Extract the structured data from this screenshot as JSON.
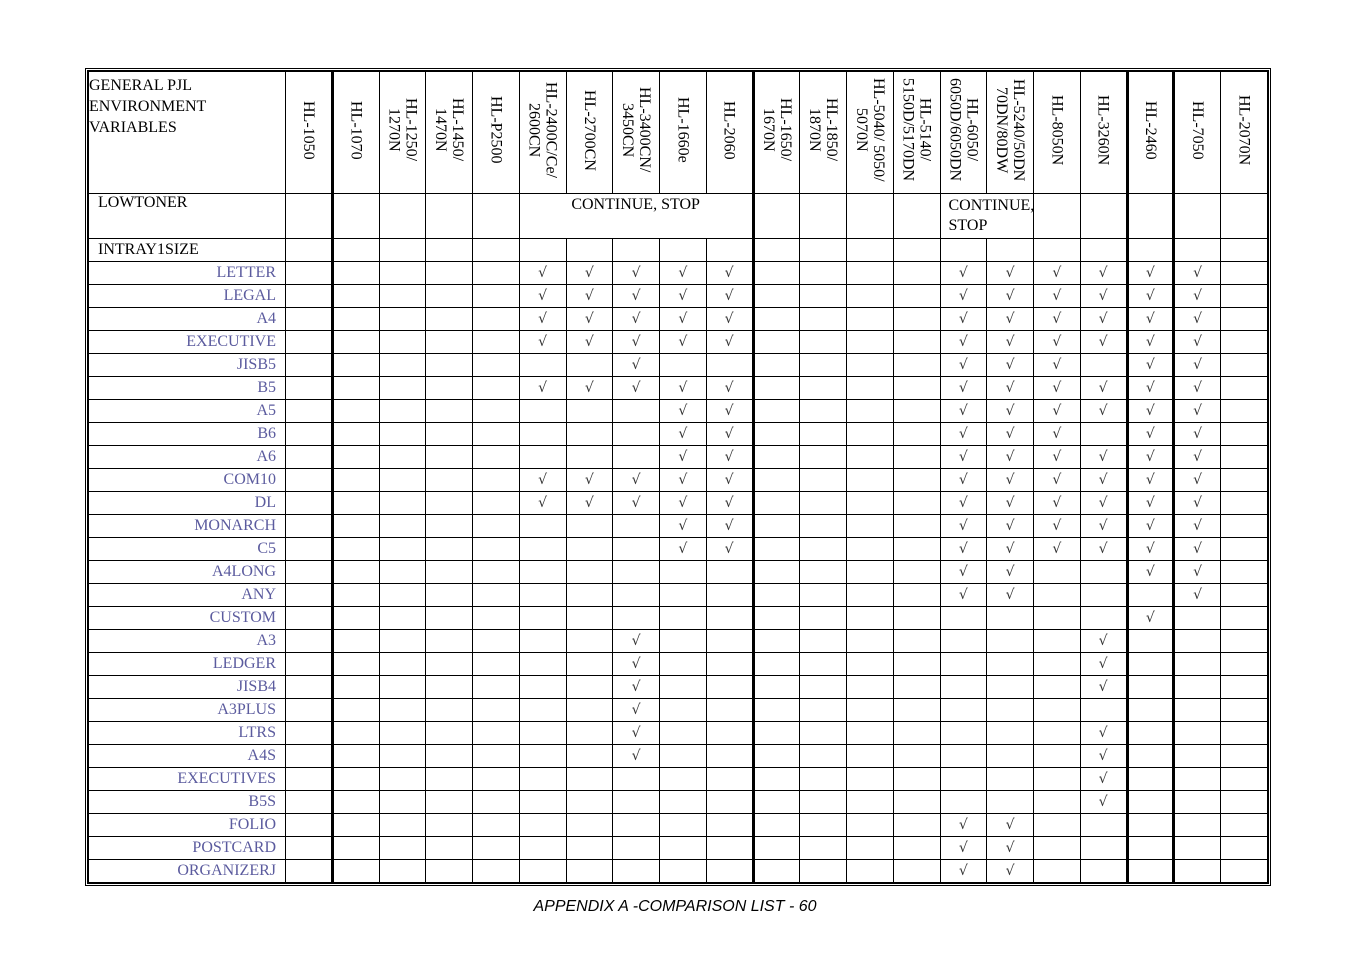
{
  "table": {
    "header_label": "GENERAL PJL ENVIRONMENT VARIABLES",
    "models": [
      "HL-1050",
      "HL-1070",
      "HL-1250/\n1270N",
      "HL-1450/\n1470N",
      "HL-P2500",
      "HL-2400C/Ce/\n2600CN",
      "HL-2700CN",
      "HL-3400CN/\n3450CN",
      "HL-1660e",
      "HL-2060",
      "HL-1650/\n1670N",
      "HL-1850/\n1870N",
      "HL-5040/ 5050/\n5070N",
      "HL-5140/\n5150D/5170DN",
      "HL-6050/\n6050D/6050DN",
      "HL-5240/50DN\n70DN/80DW",
      "HL-8050N",
      "HL-3260N",
      "HL-2460",
      "HL-7050",
      "HL-2070N"
    ],
    "thick_before": [
      1,
      10,
      18,
      19
    ],
    "lowtoner": {
      "label": "LOWTONER",
      "groups": [
        {
          "start": 5,
          "span": 5,
          "text": "CONTINUE, STOP",
          "align": "center"
        },
        {
          "start": 14,
          "span": 2,
          "text": "CONTINUE, STOP",
          "align": "left"
        }
      ]
    },
    "section_label": "INTRAY1SIZE",
    "check_symbol": "√",
    "rows": [
      {
        "label": "LETTER",
        "checks": [
          5,
          6,
          7,
          8,
          9,
          14,
          15,
          16,
          17,
          18,
          19
        ]
      },
      {
        "label": "LEGAL",
        "checks": [
          5,
          6,
          7,
          8,
          9,
          14,
          15,
          16,
          17,
          18,
          19
        ]
      },
      {
        "label": "A4",
        "checks": [
          5,
          6,
          7,
          8,
          9,
          14,
          15,
          16,
          17,
          18,
          19
        ]
      },
      {
        "label": "EXECUTIVE",
        "checks": [
          5,
          6,
          7,
          8,
          9,
          14,
          15,
          16,
          17,
          18,
          19
        ]
      },
      {
        "label": "JISB5",
        "checks": [
          7,
          14,
          15,
          16,
          18,
          19
        ]
      },
      {
        "label": "B5",
        "checks": [
          5,
          6,
          7,
          8,
          9,
          14,
          15,
          16,
          17,
          18,
          19
        ]
      },
      {
        "label": "A5",
        "checks": [
          8,
          9,
          14,
          15,
          16,
          17,
          18,
          19
        ]
      },
      {
        "label": "B6",
        "checks": [
          8,
          9,
          14,
          15,
          16,
          18,
          19
        ]
      },
      {
        "label": "A6",
        "checks": [
          8,
          9,
          14,
          15,
          16,
          17,
          18,
          19
        ]
      },
      {
        "label": "COM10",
        "checks": [
          5,
          6,
          7,
          8,
          9,
          14,
          15,
          16,
          17,
          18,
          19
        ]
      },
      {
        "label": "DL",
        "checks": [
          5,
          6,
          7,
          8,
          9,
          14,
          15,
          16,
          17,
          18,
          19
        ]
      },
      {
        "label": "MONARCH",
        "checks": [
          8,
          9,
          14,
          15,
          16,
          17,
          18,
          19
        ]
      },
      {
        "label": "C5",
        "checks": [
          8,
          9,
          14,
          15,
          16,
          17,
          18,
          19
        ]
      },
      {
        "label": "A4LONG",
        "checks": [
          14,
          15,
          18,
          19
        ]
      },
      {
        "label": "ANY",
        "checks": [
          14,
          15,
          19
        ]
      },
      {
        "label": "CUSTOM",
        "checks": [
          18
        ]
      },
      {
        "label": "A3",
        "checks": [
          7,
          17
        ]
      },
      {
        "label": "LEDGER",
        "checks": [
          7,
          17
        ]
      },
      {
        "label": "JISB4",
        "checks": [
          7,
          17
        ]
      },
      {
        "label": "A3PLUS",
        "checks": [
          7
        ]
      },
      {
        "label": "LTRS",
        "checks": [
          7,
          17
        ]
      },
      {
        "label": "A4S",
        "checks": [
          7,
          17
        ]
      },
      {
        "label": "EXECUTIVES",
        "checks": [
          17
        ]
      },
      {
        "label": "B5S",
        "checks": [
          17
        ]
      },
      {
        "label": "FOLIO",
        "checks": [
          14,
          15
        ]
      },
      {
        "label": "POSTCARD",
        "checks": [
          14,
          15
        ]
      },
      {
        "label": "ORGANIZERJ",
        "checks": [
          14,
          15
        ]
      }
    ]
  },
  "footer": "APPENDIX A -COMPARISON LIST - 60"
}
